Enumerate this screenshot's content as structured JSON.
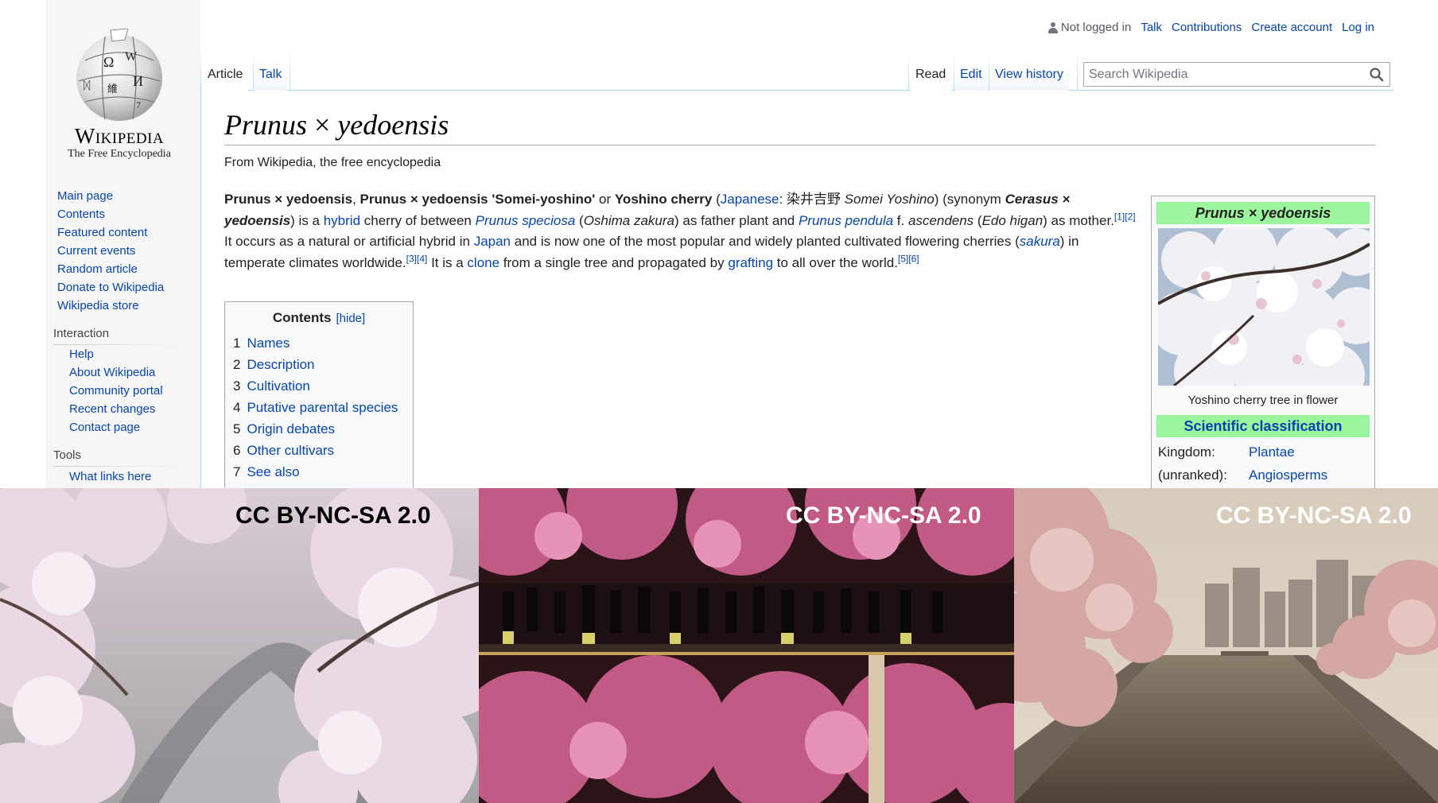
{
  "logo": {
    "title": "Wikipedia",
    "tagline": "The Free Encyclopedia",
    "globe_glyphs": [
      "Ω",
      "W",
      "И",
      "維",
      "ᛞ",
      "7"
    ]
  },
  "personal": {
    "status": "Not logged in",
    "talk": "Talk",
    "contributions": "Contributions",
    "create_account": "Create account",
    "log_in": "Log in"
  },
  "tabs": {
    "article": "Article",
    "talk": "Talk",
    "read": "Read",
    "edit": "Edit",
    "view_history": "View history"
  },
  "search": {
    "placeholder": "Search Wikipedia",
    "value": ""
  },
  "navigation": {
    "items": [
      "Main page",
      "Contents",
      "Featured content",
      "Current events",
      "Random article",
      "Donate to Wikipedia",
      "Wikipedia store"
    ]
  },
  "interaction": {
    "heading": "Interaction",
    "items": [
      "Help",
      "About Wikipedia",
      "Community portal",
      "Recent changes",
      "Contact page"
    ]
  },
  "tools": {
    "heading": "Tools",
    "items": [
      "What links here"
    ]
  },
  "article": {
    "title_genus": "Prunus",
    "title_times": "×",
    "title_species": "yedoensis",
    "site_sub": "From Wikipedia, the free encyclopedia",
    "lead": {
      "b1": "Prunus × yedoensis",
      "t1": ", ",
      "b2": "Prunus × yedoensis",
      "b3": " 'Somei-yoshino'",
      "t2": " or ",
      "b4": "Yoshino cherry",
      "t3": " (",
      "l_japanese": "Japanese",
      "t4": ": 染井吉野 ",
      "i_somei": "Somei Yoshino",
      "t5": ") (synonym ",
      "b5": "Cerasus × yedoensis",
      "t6": ") is a ",
      "l_hybrid": "hybrid",
      "t7": " cherry of between ",
      "l_speciosa": "Prunus speciosa",
      "t8": " (",
      "i_oshima": "Oshima zakura",
      "t9": ") as father plant and ",
      "l_pendula": "Prunus pendula",
      "t10": " f. ",
      "i_ascendens": "ascendens",
      "t11": " (",
      "i_edo": "Edo higan",
      "t12": ") as mother.",
      "ref12": "[1][2]",
      "t13": " It occurs as a natural or artificial hybrid in ",
      "l_japan": "Japan",
      "t14": " and is now one of the most popular and widely planted cultivated flowering cherries (",
      "l_sakura": "sakura",
      "t15": ") in temperate climates worldwide.",
      "ref34": "[3][4]",
      "t16": " It is a ",
      "l_clone": "clone",
      "t17": " from a single tree and propagated by ",
      "l_grafting": "grafting",
      "t18": " to all over the world.",
      "ref56": "[5][6]"
    }
  },
  "toc": {
    "title": "Contents",
    "hide": "[hide]",
    "items": [
      {
        "num": "1",
        "label": "Names"
      },
      {
        "num": "2",
        "label": "Description"
      },
      {
        "num": "3",
        "label": "Cultivation"
      },
      {
        "num": "4",
        "label": "Putative parental species"
      },
      {
        "num": "5",
        "label": "Origin debates"
      },
      {
        "num": "6",
        "label": "Other cultivars"
      },
      {
        "num": "7",
        "label": "See also"
      }
    ]
  },
  "infobox": {
    "title": "Prunus × yedoensis",
    "caption": "Yoshino cherry tree in flower",
    "section": "Scientific classification",
    "rows": [
      {
        "key": "Kingdom:",
        "value": "Plantae"
      },
      {
        "key": "(unranked):",
        "value": "Angiosperms"
      }
    ],
    "header_color": "#9cf49c"
  },
  "photos": {
    "license_labels": [
      "CC BY-NC-SA 2.0",
      "CC BY-NC-SA 2.0",
      "CC BY-NC-SA 2.0"
    ]
  },
  "colors": {
    "link": "#0645ad",
    "tab_border": "#a7d7f9"
  }
}
